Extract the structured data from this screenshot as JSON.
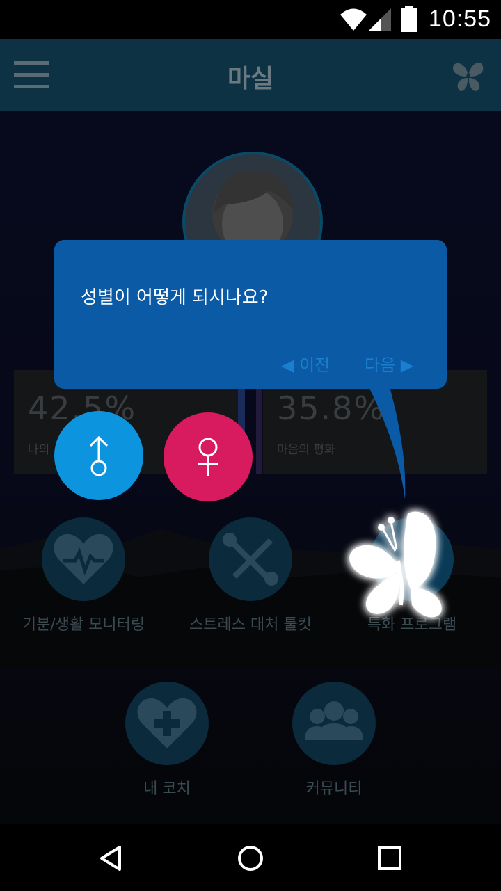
{
  "status_bar": {
    "time": "10:55"
  },
  "app_bar": {
    "title": "마실",
    "menu_icon": "hamburger-menu-icon",
    "logo_icon": "butterfly-icon"
  },
  "stats": [
    {
      "value": "42.5%",
      "label": "나의"
    },
    {
      "value": "35.8%",
      "label": "마음의 평화"
    }
  ],
  "features": [
    {
      "label": "기분/생활 모니터링",
      "icon": "heart-pulse-icon"
    },
    {
      "label": "스트레스 대처 툴킷",
      "icon": "tools-icon"
    },
    {
      "label": "특화 프로그램",
      "icon": "butterfly-icon"
    },
    {
      "label": "내 코치",
      "icon": "heart-plus-icon"
    },
    {
      "label": "커뮤니티",
      "icon": "community-icon"
    }
  ],
  "tutorial": {
    "question": "성별이 어떻게 되시나요?",
    "prev": "◀ 이전",
    "next": "다음 ▶"
  },
  "gender_options": [
    {
      "name": "male",
      "icon": "male-symbol-icon",
      "color": "#0c95de"
    },
    {
      "name": "female",
      "icon": "female-symbol-icon",
      "color": "#d81b5e"
    }
  ],
  "colors": {
    "app_bar": "#0c3244",
    "bubble": "#0b5aa6",
    "accent_link": "#1b7fcf"
  }
}
